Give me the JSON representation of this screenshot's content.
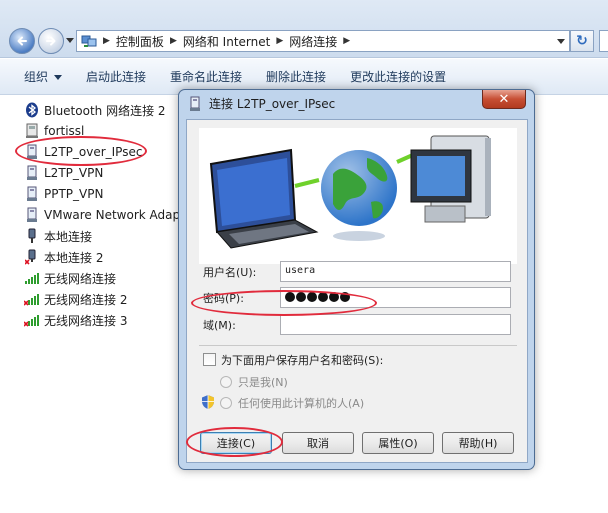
{
  "explorer": {
    "breadcrumbs": [
      "控制面板",
      "网络和 Internet",
      "网络连接"
    ],
    "commands": [
      "组织",
      "启动此连接",
      "重命名此连接",
      "删除此连接",
      "更改此连接的设置"
    ]
  },
  "connections": [
    {
      "name": "Bluetooth 网络连接 2",
      "icon": "bluetooth-icon"
    },
    {
      "name": "fortissl",
      "icon": "network-adapter-icon"
    },
    {
      "name": "L2TP_over_IPsec",
      "icon": "vpn-icon"
    },
    {
      "name": "L2TP_VPN",
      "icon": "vpn-icon"
    },
    {
      "name": "PPTP_VPN",
      "icon": "vpn-icon"
    },
    {
      "name": "VMware Network Adap",
      "icon": "network-adapter-icon"
    },
    {
      "name": "本地连接",
      "icon": "ethernet-icon"
    },
    {
      "name": "本地连接 2",
      "icon": "ethernet-disconnected-icon"
    },
    {
      "name": "无线网络连接",
      "icon": "wireless-signal-icon"
    },
    {
      "name": "无线网络连接 2",
      "icon": "wireless-disconnected-icon"
    },
    {
      "name": "无线网络连接 3",
      "icon": "wireless-disconnected-icon"
    }
  ],
  "dialog": {
    "title": "连接 L2TP_over_IPsec",
    "close_label": "✕",
    "username_label": "用户名(U):",
    "username_value": "usera",
    "password_label": "密码(P):",
    "password_dot_count": 6,
    "domain_label": "域(M):",
    "domain_value": "",
    "save_checkbox_label": "为下面用户保存用户名和密码(S):",
    "save_checked": false,
    "radio_me_only": "只是我(N)",
    "radio_anyone": "任何使用此计算机的人(A)",
    "buttons": {
      "connect": "连接(C)",
      "cancel": "取消",
      "properties": "属性(O)",
      "help": "帮助(H)"
    }
  },
  "colors": {
    "annotation_red": "#e12b3c",
    "dialog_frame": "#bfd4ec",
    "close_button": "#c74f34"
  }
}
